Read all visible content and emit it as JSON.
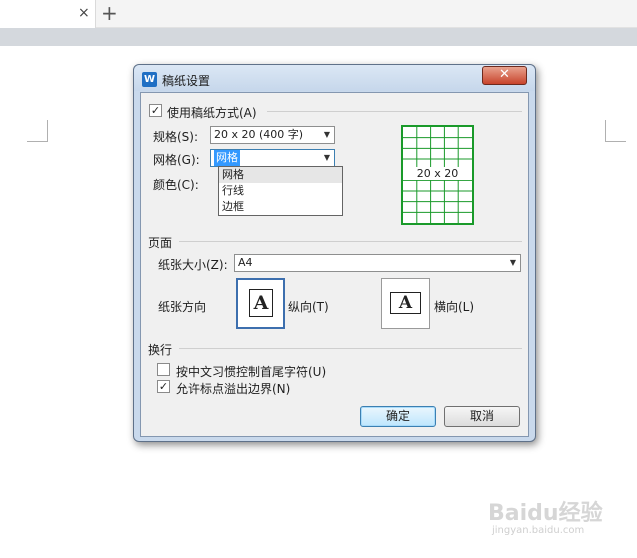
{
  "browser": {
    "tab_close_glyph": "×",
    "new_tab_glyph": "+"
  },
  "dialog": {
    "title": "稿纸设置",
    "app_icon_letter": "W",
    "close_glyph": "✕",
    "use_grid": {
      "label": "使用稿纸方式(A)",
      "checked": true,
      "check_glyph": "✓"
    },
    "spec": {
      "label": "规格(S):",
      "value": "20 x 20 (400 字)"
    },
    "grid": {
      "label": "网格(G):",
      "value": "网格",
      "options": [
        "网格",
        "行线",
        "边框"
      ],
      "highlighted_index": 0
    },
    "color": {
      "label": "颜色(C):"
    },
    "preview": {
      "label": "20 x 20",
      "line_color": "#1a9a2a"
    },
    "page_section": {
      "heading": "页面",
      "paper_size": {
        "label": "纸张大小(Z):",
        "value": "A4"
      },
      "orientation": {
        "label": "纸张方向",
        "portrait": {
          "glyph": "A",
          "label": "纵向(T)",
          "selected": true
        },
        "landscape": {
          "glyph": "A",
          "label": "横向(L)",
          "selected": false
        }
      }
    },
    "wrap_section": {
      "heading": "换行",
      "options": [
        {
          "label": "按中文习惯控制首尾字符(U)",
          "checked": false,
          "check_glyph": ""
        },
        {
          "label": "允许标点溢出边界(N)",
          "checked": true,
          "check_glyph": "✓"
        }
      ]
    },
    "buttons": {
      "ok": "确定",
      "cancel": "取消"
    }
  },
  "watermark": {
    "main": "Baidu经验",
    "sub": "jingyan.baidu.com"
  },
  "colors": {
    "accent": "#3c7fb1",
    "preview_green": "#1a9a2a",
    "close_red": "#c8442c"
  }
}
